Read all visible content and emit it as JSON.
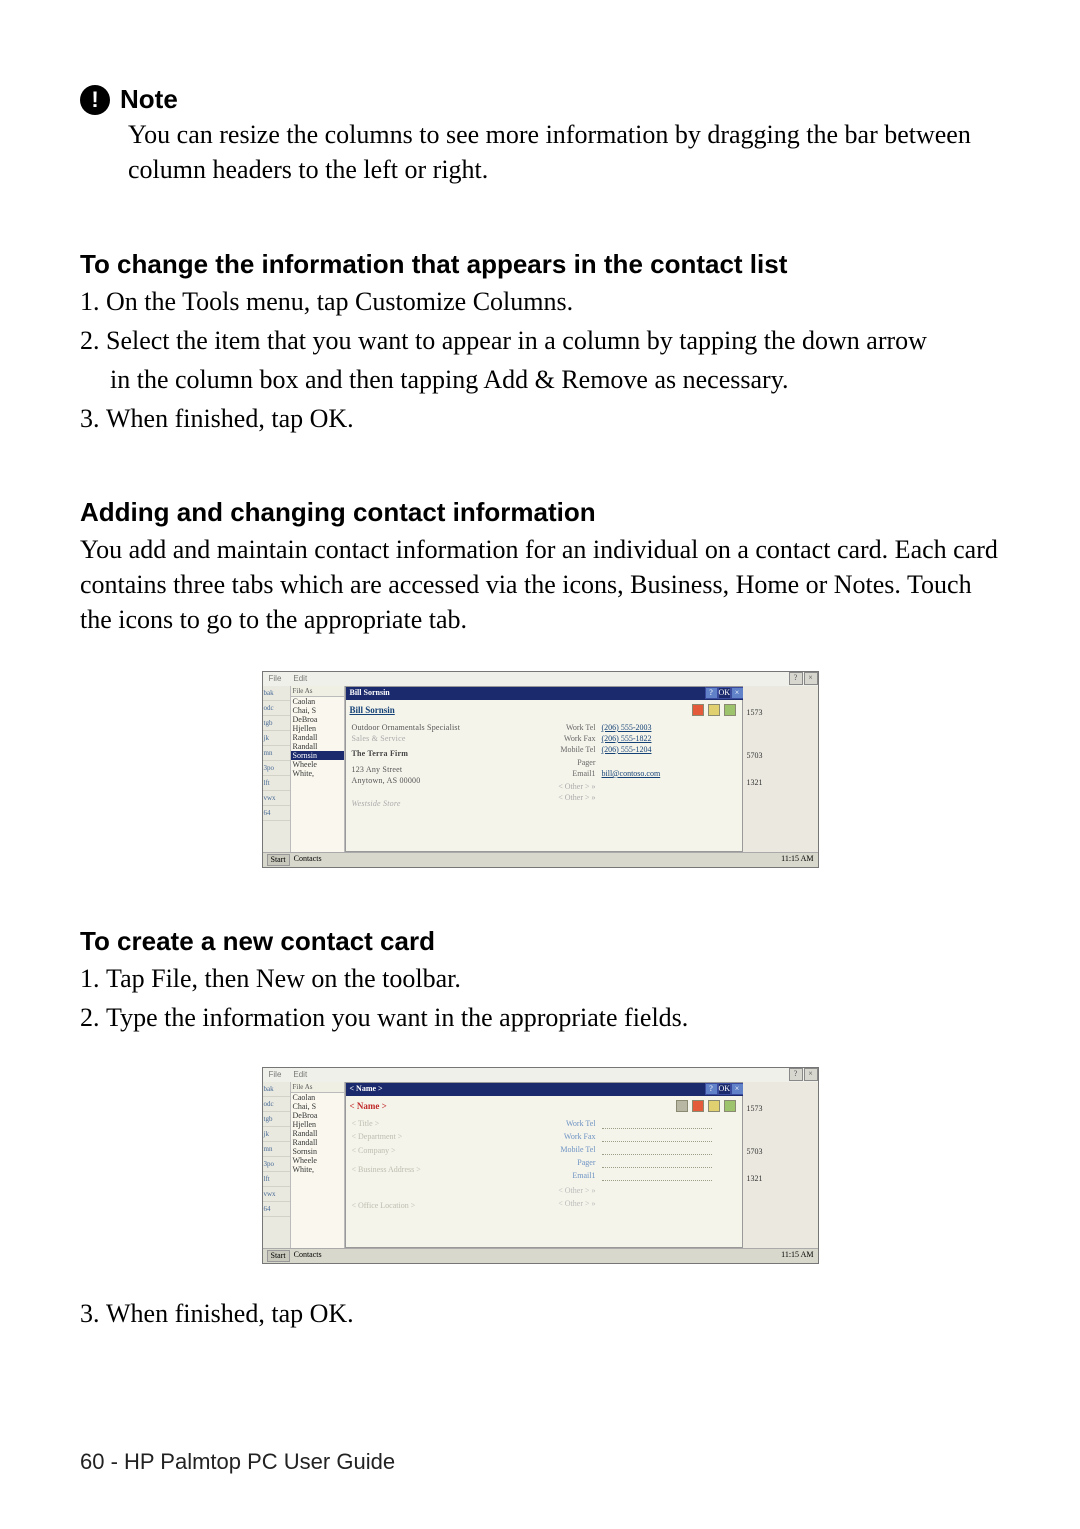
{
  "note": {
    "label": "Note",
    "body": "You can resize the columns to see more information by dragging the bar between column headers to the left or right."
  },
  "sec1": {
    "h": "To change the information that appears in the contact list",
    "i1": "On the Tools menu, tap Customize Columns.",
    "i2a": "Select the item that you want to appear in a column by tapping the down arrow",
    "i2b": "in the column box and then tapping Add & Remove as necessary.",
    "i3": "When finished, tap OK."
  },
  "sec2": {
    "h": "Adding and changing contact information",
    "p": "You add and maintain contact information for an individual on a contact card. Each card contains three tabs which are accessed via the icons, Business, Home or Notes.  Touch the icons to go to the appropriate tab."
  },
  "sec3": {
    "h": "To create a new contact card",
    "i1": "Tap File, then New on the toolbar.",
    "i2": "Type the information you want in the appropriate fields.",
    "i3": "When finished, tap OK."
  },
  "shot1": {
    "file": "File",
    "edit": "Edit",
    "bgQ": "?",
    "bgOK": "OK",
    "bgX": "×",
    "shell_title": "Bill Sornsin",
    "list_header": "File As",
    "list": [
      "Caolan",
      "Chai, S",
      "DeBroa",
      "Hjellen",
      "Randall",
      "Randall",
      "Sornsin",
      "Wheele",
      "White,"
    ],
    "detail_name": "Bill Sornsin",
    "d1": "Outdoor Ornamentals Specialist",
    "d2": "Sales & Service",
    "d3": "The Terra Firm",
    "d4": "123 Any Street",
    "d5": "Anytown, AS 00000",
    "d6": "Westside Store",
    "lab_wt": "Work Tel",
    "val_wt": "(206) 555-2003",
    "lab_wf": "Work Fax",
    "val_wf": "(206) 555-1822",
    "lab_mt": "Mobile Tel",
    "val_mt": "(206) 555-1204",
    "lab_pg": "Pager",
    "lab_em": "Email1",
    "val_em": "bill@contoso.com",
    "lab_o1": "< Other >  »",
    "lab_o2": "< Other >  »",
    "right": [
      "1573",
      "5703",
      "1321"
    ],
    "sidebar": [
      "bak",
      "odc",
      "tgb",
      "jk",
      "mn",
      "3po",
      "lft",
      "vwx",
      "64"
    ],
    "task_l1": "Start",
    "task_l2": "Contacts",
    "task_r": "11:15 AM"
  },
  "shot2": {
    "file": "File",
    "edit": "Edit",
    "shell_title": "< Name >",
    "detail_name": "< Name >",
    "ph_title": "< Title >",
    "ph_dept": "< Department >",
    "ph_comp": "< Company >",
    "ph_addr": "< Business Address >",
    "ph_loc": "< Office Location >",
    "lab_wt": "Work Tel",
    "lab_wf": "Work Fax",
    "lab_mt": "Mobile Tel",
    "lab_pg": "Pager",
    "lab_em": "Email1",
    "lab_o1": "< Other >  »",
    "lab_o2": "< Other >  »",
    "right": [
      "1573",
      "5703",
      "1321"
    ],
    "list_header": "File As",
    "list": [
      "Caolan",
      "Chai, S",
      "DeBroa",
      "Hjellen",
      "Randall",
      "Randall",
      "Sornsin",
      "Wheele",
      "White,"
    ],
    "sidebar": [
      "bak",
      "odc",
      "tgb",
      "jk",
      "mn",
      "3po",
      "lft",
      "vwx",
      "64"
    ],
    "task_l1": "Start",
    "task_l2": "Contacts",
    "task_r": "11:15 AM"
  },
  "footer": "60 - HP Palmtop PC User Guide"
}
